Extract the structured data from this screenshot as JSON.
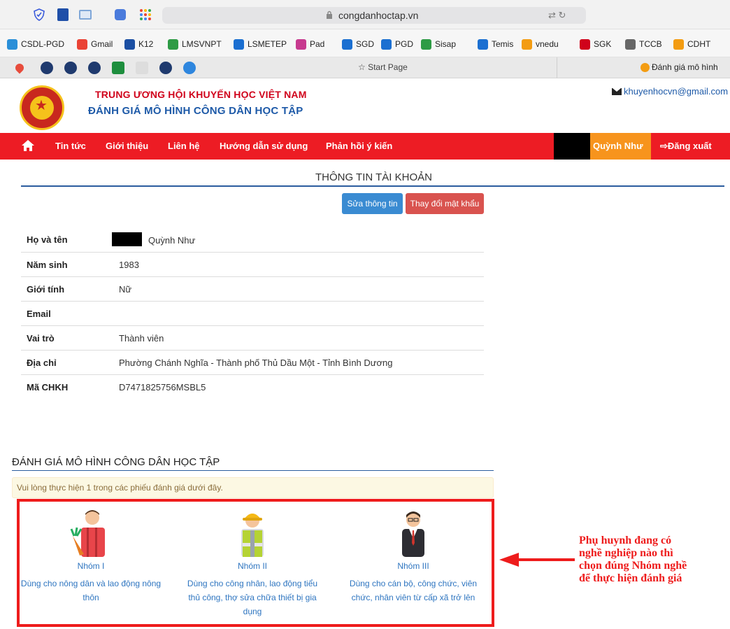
{
  "browser": {
    "url": "congdanhoctap.vn",
    "start_page": "Start Page",
    "active_tab_title": "Đánh giá mô hình",
    "bookmarks": [
      {
        "label": "CSDL-PGD",
        "color": "#2a8fd8"
      },
      {
        "label": "Gmail",
        "color": "#ea4335"
      },
      {
        "label": "K12",
        "color": "#1b4fa3"
      },
      {
        "label": "LMSVNPT",
        "color": "#2e9b45"
      },
      {
        "label": "LSMETEP",
        "color": "#1b6fd1"
      },
      {
        "label": "Pad",
        "color": "#c73a8f"
      },
      {
        "label": "SGD",
        "color": "#1b6fd1"
      },
      {
        "label": "PGD",
        "color": "#1b6fd1"
      },
      {
        "label": "Sisap",
        "color": "#2e9b45"
      },
      {
        "label": "Temis",
        "color": "#1b6fd1"
      },
      {
        "label": "vnedu",
        "color": "#f39c12"
      },
      {
        "label": "SGK",
        "color": "#d0021b"
      },
      {
        "label": "TCCB",
        "color": "#666666"
      },
      {
        "label": "CDHT",
        "color": "#f39c12"
      }
    ]
  },
  "header": {
    "org_name": "TRUNG ƯƠNG HỘI KHUYẾN HỌC VIỆT NAM",
    "site_title": "ĐÁNH GIÁ MÔ HÌNH CÔNG DÂN HỌC TẬP",
    "email": "khuyenhocvn@gmail.com"
  },
  "nav": {
    "items": [
      "Tin tức",
      "Giới thiệu",
      "Liên hệ",
      "Hướng dẫn sử dụng",
      "Phản hồi ý kiến"
    ],
    "user": "Quỳnh Như",
    "logout": "⇨Đăng xuất"
  },
  "account": {
    "title": "THÔNG TIN TÀI KHOẢN",
    "edit_button": "Sửa thông tin",
    "password_button": "Thay đổi mật khẩu",
    "rows": [
      {
        "label": "Họ và tên",
        "value": "Quỳnh Như"
      },
      {
        "label": "Năm sinh",
        "value": "1983"
      },
      {
        "label": "Giới tính",
        "value": "Nữ"
      },
      {
        "label": "Email",
        "value": ""
      },
      {
        "label": "Vai trò",
        "value": "Thành viên"
      },
      {
        "label": "Địa chỉ",
        "value": "Phường Chánh Nghĩa - Thành phố Thủ Dầu Một - Tỉnh Bình Dương"
      },
      {
        "label": "Mã CHKH",
        "value": "D7471825756MSBL5"
      }
    ]
  },
  "evaluation": {
    "title": "ĐÁNH GIÁ MÔ HÌNH CÔNG DÂN HỌC TẬP",
    "notice": "Vui lòng thực hiện 1 trong các phiếu đánh giá dưới đây.",
    "groups": [
      {
        "name": "Nhóm I",
        "desc_lines": [
          "Dùng cho nông dân và lao động nông",
          "thôn"
        ]
      },
      {
        "name": "Nhóm II",
        "desc_lines": [
          "Dùng cho công nhân, lao động tiểu",
          "thủ công, thợ sửa chữa thiết bị gia",
          "dụng"
        ]
      },
      {
        "name": "Nhóm III",
        "desc_lines": [
          "Dùng cho cán bộ, công chức, viên",
          "chức, nhân viên từ cấp xã trở lên"
        ]
      }
    ]
  },
  "annotation": {
    "lines": [
      "Phụ huynh đang có",
      "nghề nghiệp nào thì",
      "chọn đúng Nhóm nghề",
      "để thực hiện đánh giá"
    ]
  }
}
